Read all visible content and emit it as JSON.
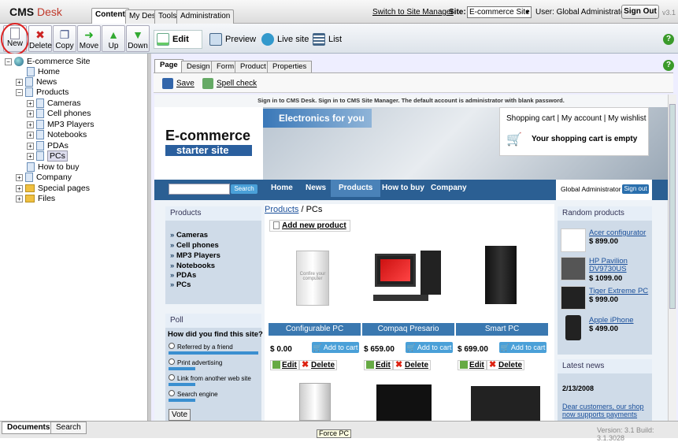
{
  "app": {
    "logo_cms": "CMS",
    "logo_desk": "Desk",
    "version_top": "v3.1"
  },
  "top_tabs": [
    "Content",
    "My Desk",
    "Tools",
    "Administration"
  ],
  "header": {
    "switch_link": "Switch to Site Manager",
    "site_label": "Site:",
    "site_value": "E-commerce Site",
    "user_label": "User: Global Administrator",
    "signout": "Sign Out"
  },
  "toolbar": {
    "buttons": [
      "New",
      "Delete",
      "Copy",
      "Move",
      "Up",
      "Down"
    ],
    "views": [
      "Edit",
      "Preview",
      "Live site",
      "List"
    ]
  },
  "tree": {
    "root": "E-commerce Site",
    "items": [
      "Home",
      "News",
      "Products",
      "Cameras",
      "Cell phones",
      "MP3 Players",
      "Notebooks",
      "PDAs",
      "PCs",
      "How to buy",
      "Company",
      "Special pages",
      "Files"
    ]
  },
  "page_tabs": [
    "Page",
    "Design",
    "Form",
    "Product",
    "Properties"
  ],
  "page_actions": {
    "save": "Save",
    "spell": "Spell check"
  },
  "site": {
    "signin_notice": "Sign in to CMS Desk. Sign in to CMS Site Manager. The default account is administrator with blank password.",
    "brand_line1": "E-commerce",
    "brand_line2": "starter site",
    "banner_text": "Electronics for you",
    "cart_links": "Shopping cart | My account | My wishlist",
    "cart_status": "Your shopping cart is empty",
    "search_button": "Search",
    "nav": [
      "Home",
      "News",
      "Products",
      "How to buy",
      "Company"
    ],
    "user_name": "Global Administrator",
    "signout": "Sign out",
    "products_box": "Products",
    "categories": [
      "Cameras",
      "Cell phones",
      "MP3 Players",
      "Notebooks",
      "PDAs",
      "PCs"
    ],
    "breadcrumb_link": "Products",
    "breadcrumb_rest": " / PCs",
    "add_product": "Add new product",
    "products": [
      {
        "name": "Configurable PC",
        "price": "$ 0.00",
        "img_text": "Confire your computer"
      },
      {
        "name": "Compaq Presario",
        "price": "$ 659.00"
      },
      {
        "name": "Smart PC",
        "price": "$ 699.00"
      }
    ],
    "add_to_cart": "Add to cart",
    "edit": "Edit",
    "delete": "Delete",
    "poll": {
      "title": "Poll",
      "question": "How did you find this site?",
      "options": [
        "Referred by a friend",
        "Print advertising",
        "Link from another web site",
        "Search engine"
      ],
      "vote": "Vote"
    },
    "random": {
      "title": "Random products",
      "items": [
        {
          "name": "Acer configurator",
          "price": "$ 899.00"
        },
        {
          "name": "HP Pavilion DV9730US",
          "price": "$ 1099.00"
        },
        {
          "name": "Tiger Extreme PC",
          "price": "$ 999.00"
        },
        {
          "name": "Apple iPhone",
          "price": "$ 499.00"
        }
      ]
    },
    "news": {
      "title": "Latest news",
      "date": "2/13/2008",
      "text": "Dear customers, our shop now supports payments"
    }
  },
  "bottom": {
    "tabs": [
      "Documents",
      "Search"
    ],
    "tooltip": "Force PC",
    "version": "Version: 3.1 Build: 3.1.3028"
  },
  "colors": {
    "accent": "#2a6fad",
    "nav": "#2b5f93",
    "highlight_circle": "#dd2222"
  }
}
